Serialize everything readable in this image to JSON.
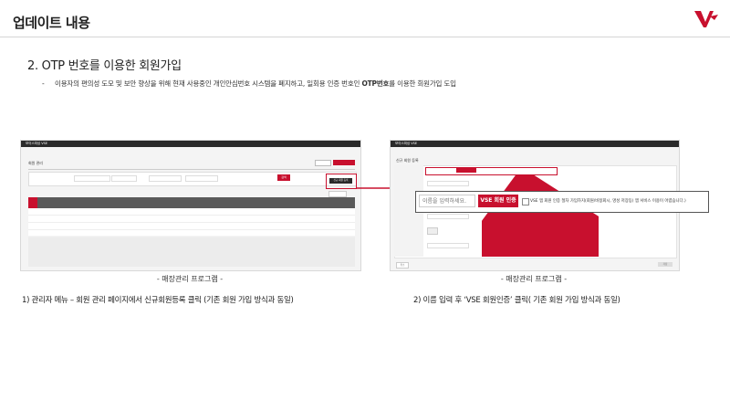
{
  "page_title": "업데이트 내용",
  "section_title": "2. OTP 번호를 이용한 회원가입",
  "bullet": {
    "dash": "-",
    "pre": "이용자의 편의성 도모 및 보안 향상을 위해 현재 사용중인 개인안심번호 시스템을 폐지하고, 일회용 인증 번호인 ",
    "bold1": "OTP번호",
    "post": "를 이용한 회원가입 도입"
  },
  "left_shot": {
    "brand": "보이스피싱 VSE",
    "header_title": "회원 관리",
    "register_label": "신규 회원 등록",
    "search_label": "검색",
    "table_headers": [
      "No",
      "성명",
      "직급",
      "휴대전화",
      "성별",
      "가입일",
      "구분",
      "최종접속",
      "비고"
    ],
    "row_count": 4
  },
  "right_shot": {
    "brand": "보이스피싱 VSE",
    "header_title": "신규 회원 등록",
    "name_placeholder": "이름을 입력하세요.",
    "verify_button": "VSE 회원 인증",
    "consent_text": "VSE 앱 회원 인증 절차 가입하지(회원/비정회시, 명성 저장등) 앱 서비스 이용이 어렵습니다.)",
    "cancel_label": "취소",
    "save_label": "저장"
  },
  "caption_left": "- 매장관리 프로그램 -",
  "caption_right": "- 매장관리 프로그램 -",
  "step1": "1) 관리자 메뉴 – 회원 관리 페이지에서 신규회원등록 클릭 (기존 회원 가입 방식과 동일)",
  "step2": "2) 이름 입력 후 ‘VSE 회원인증’ 클릭( 기존 회원 가입 방식과 동일)",
  "colors": {
    "accent": "#c8102e",
    "dark": "#2a2a2a"
  }
}
